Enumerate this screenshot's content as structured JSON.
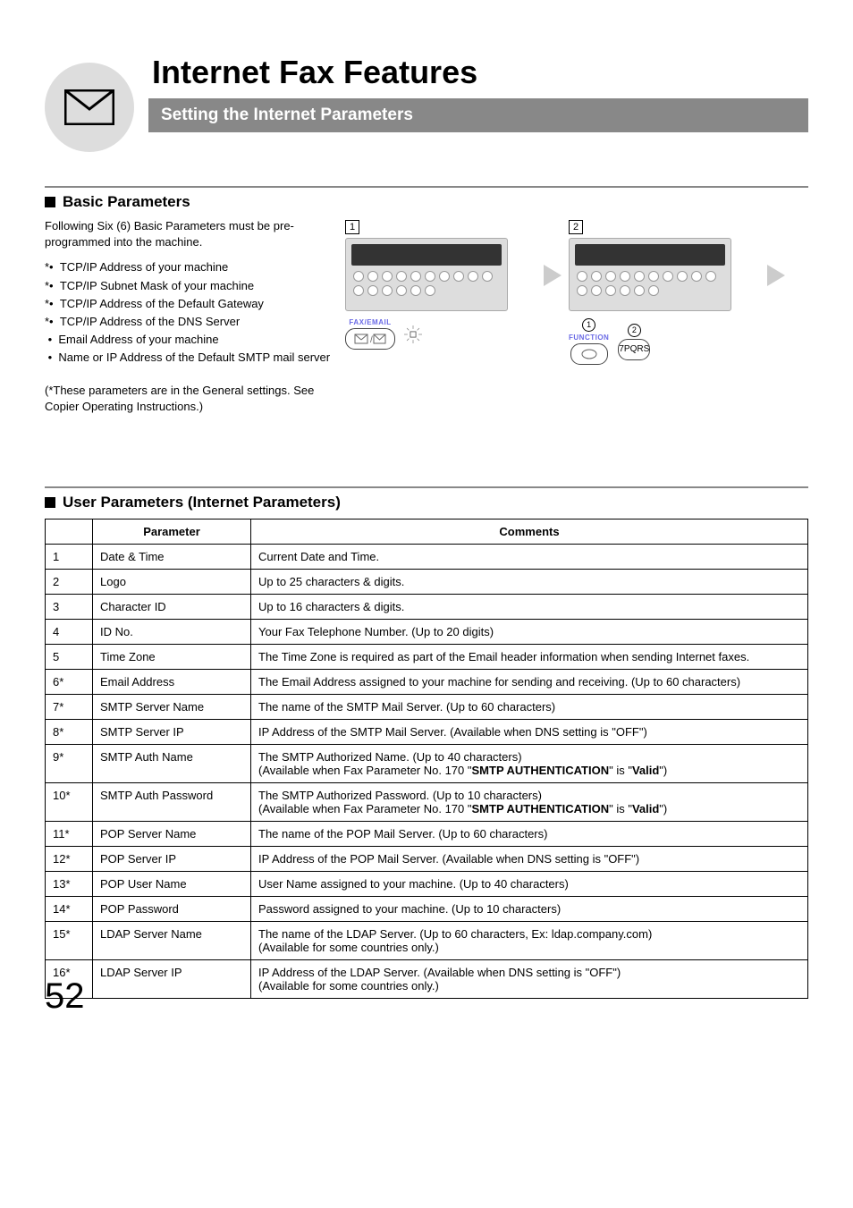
{
  "header": {
    "title": "Internet Fax Features",
    "subtitle": "Setting the Internet Parameters"
  },
  "section1": {
    "title": "Basic Parameters",
    "intro": "Following Six (6) Basic Parameters must be pre-programmed into the machine.",
    "items": [
      "*•  TCP/IP Address of your machine",
      "*•  TCP/IP Subnet Mask of your machine",
      "*•  TCP/IP Address of the Default Gateway",
      "*•  TCP/IP Address of the DNS Server",
      " •  Email Address of your machine",
      " •  Name or IP Address of the Default SMTP mail server"
    ],
    "note": "(*These parameters are in the General settings. See Copier Operating Instructions.)",
    "step1_num": "1",
    "step2_num": "2",
    "key_label_1": "FAX/EMAIL",
    "key_label_2": "FUNCTION",
    "circled_1": "1",
    "circled_2": "2",
    "key7": "7PQRS"
  },
  "section2": {
    "title": "User Parameters (Internet Parameters)",
    "columns": {
      "c1": "",
      "c2": "Parameter",
      "c3": "Comments"
    },
    "rows": [
      {
        "n": "1",
        "p": "Date & Time",
        "c": "Current Date and Time."
      },
      {
        "n": "2",
        "p": "Logo",
        "c": "Up to 25 characters & digits."
      },
      {
        "n": "3",
        "p": "Character ID",
        "c": "Up to 16 characters & digits."
      },
      {
        "n": "4",
        "p": "ID No.",
        "c": "Your Fax Telephone Number. (Up to 20 digits)"
      },
      {
        "n": "5",
        "p": "Time Zone",
        "c": "The Time Zone is required as part of the Email header information when sending Internet faxes."
      },
      {
        "n": "6*",
        "p": "Email Address",
        "c": "The Email Address assigned to your machine for sending and receiving. (Up to 60 characters)"
      },
      {
        "n": "7*",
        "p": "SMTP Server Name",
        "c": "The name of the SMTP Mail Server. (Up to 60 characters)"
      },
      {
        "n": "8*",
        "p": "SMTP Server IP",
        "c": "IP Address of the SMTP Mail Server. (Available when DNS setting is \"OFF\")"
      },
      {
        "n": "9*",
        "p": "SMTP Auth Name",
        "c_pre": "The SMTP Authorized Name. (Up to 40 characters)\n(Available when Fax Parameter No. 170 \"",
        "c_bold": "SMTP AUTHENTICATION",
        "c_mid": "\" is \"",
        "c_bold2": "Valid",
        "c_post": "\")"
      },
      {
        "n": "10*",
        "p": "SMTP Auth Password",
        "c_pre": "The SMTP Authorized Password. (Up to 10 characters)\n(Available when Fax Parameter No. 170 \"",
        "c_bold": "SMTP AUTHENTICATION",
        "c_mid": "\" is \"",
        "c_bold2": "Valid",
        "c_post": "\")"
      },
      {
        "n": "11*",
        "p": "POP Server Name",
        "c": "The name of the POP Mail Server. (Up to 60 characters)"
      },
      {
        "n": "12*",
        "p": "POP Server IP",
        "c": "IP Address of the POP Mail Server. (Available when DNS setting is \"OFF\")"
      },
      {
        "n": "13*",
        "p": "POP User Name",
        "c": "User Name assigned to your machine. (Up to 40 characters)"
      },
      {
        "n": "14*",
        "p": "POP Password",
        "c": "Password assigned to your machine. (Up to 10 characters)"
      },
      {
        "n": "15*",
        "p": "LDAP Server Name",
        "c": "The name of the LDAP Server. (Up to 60 characters, Ex: ldap.company.com)\n(Available for some countries only.)"
      },
      {
        "n": "16*",
        "p": "LDAP Server IP",
        "c": "IP Address of the LDAP Server. (Available when DNS setting is \"OFF\")\n(Available for some countries only.)"
      }
    ]
  },
  "page_number": "52"
}
